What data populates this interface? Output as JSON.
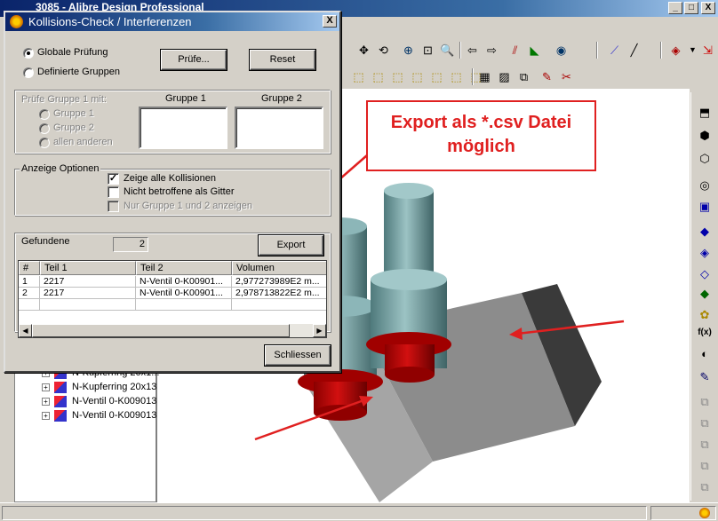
{
  "app": {
    "title": "3085 - Alibre Design Professional",
    "window_buttons": {
      "minimize": "_",
      "restore": "□",
      "close": "X"
    }
  },
  "dialog": {
    "title": "Kollisions-Check / Interferenzen",
    "close": "X",
    "radio_global": "Globale Prüfung",
    "radio_defined": "Definierte Gruppen",
    "radio_selected": "Globale Prüfung",
    "check_button": "Prüfe...",
    "reset_button": "Reset",
    "group_section_label": "Prüfe Gruppe 1 mit:",
    "group_options": [
      "Gruppe 1",
      "Gruppe 2",
      "allen anderen"
    ],
    "group1_header": "Gruppe 1",
    "group2_header": "Gruppe 2",
    "display_options_label": "Anzeige Optionen",
    "option_show_all": "Zeige alle Kollisionen",
    "option_show_all_checked": true,
    "option_unaffected_wire": "Nicht betroffene als Gitter",
    "option_unaffected_wire_checked": false,
    "option_only_groups": "Nur Gruppe 1 und 2 anzeigen",
    "option_only_groups_checked": false,
    "found_label": "Gefundene",
    "found_count": "2",
    "export_button": "Export",
    "results": {
      "columns": [
        "#",
        "Teil 1",
        "Teil 2",
        "Volumen"
      ],
      "rows": [
        [
          "1",
          "2217",
          "N-Ventil 0-K00901...",
          "2,977273989E2 m..."
        ],
        [
          "2",
          "2217",
          "N-Ventil 0-K00901...",
          "2,978713822E2 m..."
        ]
      ]
    },
    "close_button": "Schliessen"
  },
  "tree": {
    "items": [
      "N-Kupferring 20x1...",
      "N-Kupferring 20x13",
      "N-Ventil 0-K009013",
      "N-Ventil 0-K009013"
    ]
  },
  "callout": {
    "line1": "Export als *.csv Datei",
    "line2": "möglich"
  },
  "colors": {
    "annotation_red": "#e02020",
    "cylinder": "#6e9c9e",
    "collision_red": "#b50000",
    "block": "#9a9a9a"
  }
}
